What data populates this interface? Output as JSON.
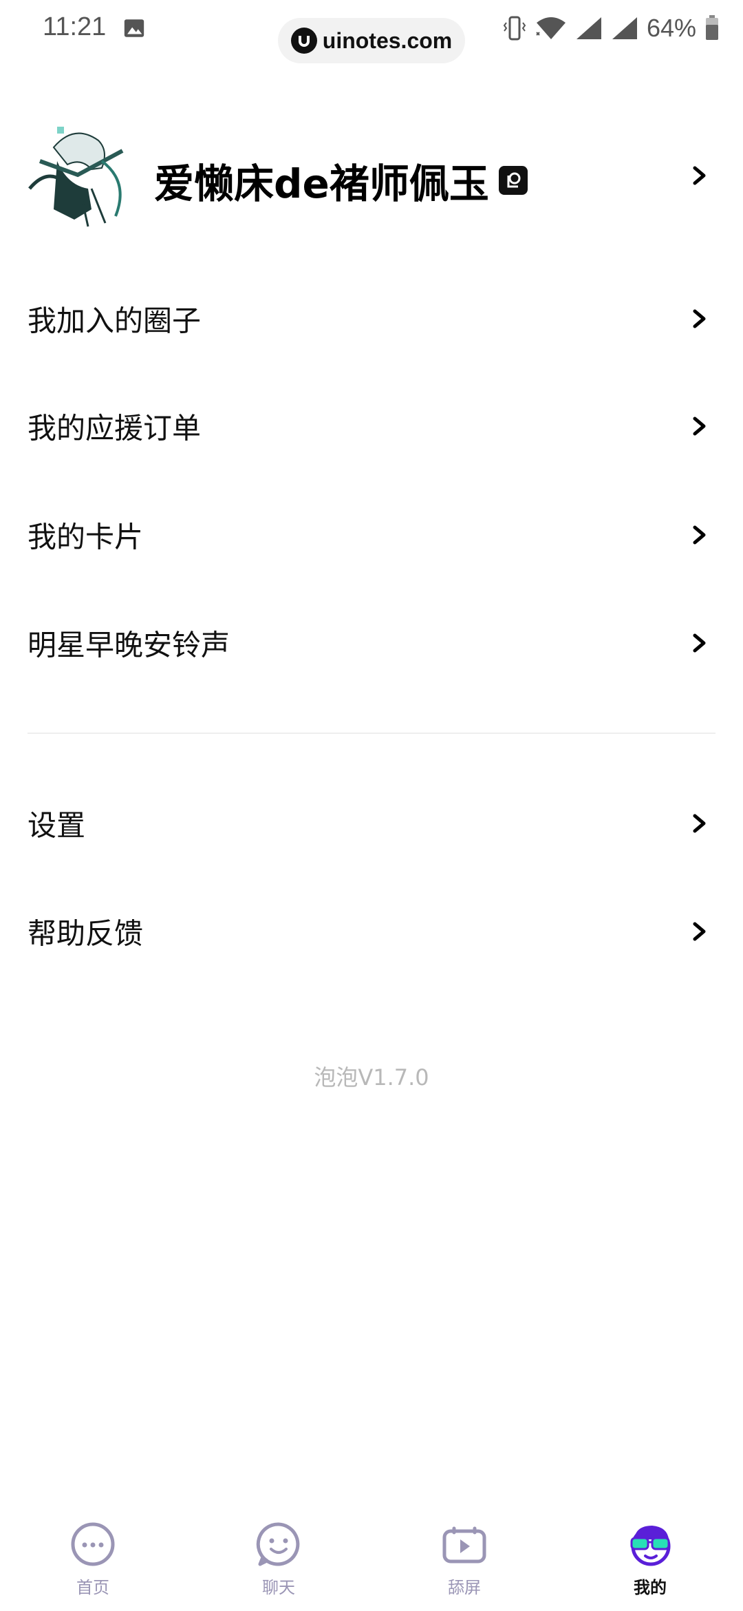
{
  "status_bar": {
    "time": "11:21",
    "url": "uinotes.com",
    "battery": "64%"
  },
  "profile": {
    "name": "爱懒床de褚师佩玉"
  },
  "menu_group1": [
    {
      "label": "我加入的圈子"
    },
    {
      "label": "我的应援订单"
    },
    {
      "label": "我的卡片"
    },
    {
      "label": "明星早晚安铃声"
    }
  ],
  "menu_group2": [
    {
      "label": "设置"
    },
    {
      "label": "帮助反馈"
    }
  ],
  "version": "泡泡V1.7.0",
  "bottom_nav": [
    {
      "label": "首页",
      "icon": "chat-dots-icon",
      "active": false
    },
    {
      "label": "聊天",
      "icon": "smiley-bubble-icon",
      "active": false
    },
    {
      "label": "舔屏",
      "icon": "tv-play-icon",
      "active": false
    },
    {
      "label": "我的",
      "icon": "sunglasses-face-icon",
      "active": true
    }
  ],
  "colors": {
    "nav_inactive": "#9a95b5",
    "accent_purple": "#5a1fd8",
    "accent_teal": "#28e0b6"
  }
}
